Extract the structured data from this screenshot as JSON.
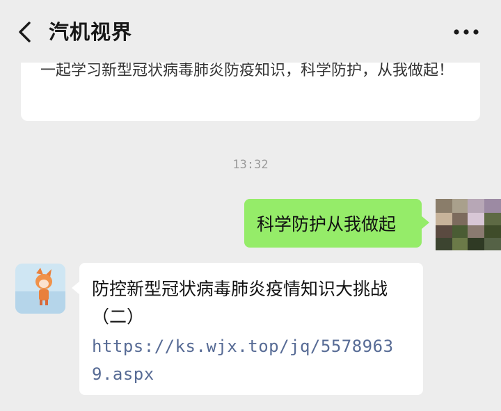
{
  "header": {
    "title": "汽机视界",
    "back_icon": "chevron-left-icon",
    "more_icon": "ellipsis-icon"
  },
  "messages": {
    "previous_card_text": "一起学习新型冠状病毒肺炎防疫知识，科学防护，从我做起！",
    "timestamp": "13:32",
    "sent_text": "科学防护从我做起",
    "received_text": "防控新型冠状病毒肺炎疫情知识大挑战（二）",
    "received_link": "https://ks.wjx.top/jq/55789639.aspx"
  },
  "colors": {
    "background": "#ededed",
    "sent_bubble": "#95ec69",
    "received_bubble": "#ffffff",
    "link": "#576b95",
    "timestamp": "#9a9a9a"
  }
}
